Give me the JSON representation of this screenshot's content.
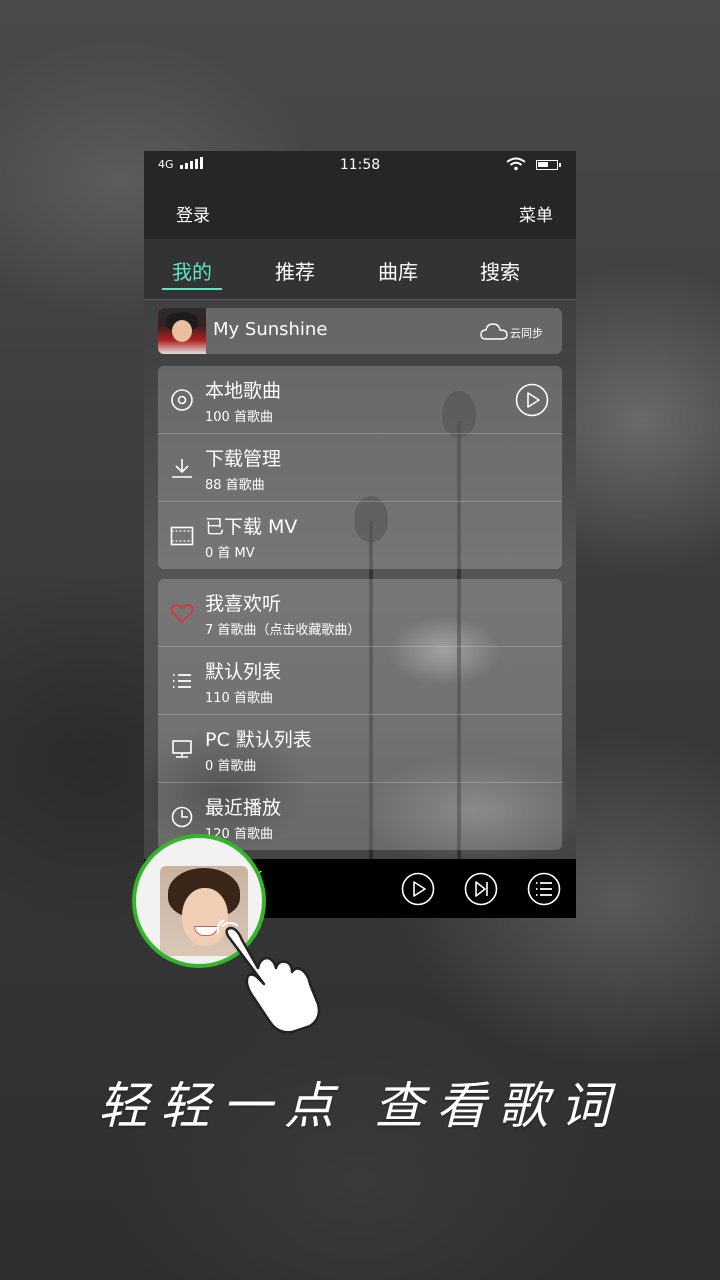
{
  "status_bar": {
    "network": "4G",
    "time": "11:58"
  },
  "header": {
    "login_label": "登录",
    "menu_label": "菜单"
  },
  "tabs": [
    {
      "label": "我的",
      "active": true
    },
    {
      "label": "推荐",
      "active": false
    },
    {
      "label": "曲库",
      "active": false
    },
    {
      "label": "搜索",
      "active": false
    }
  ],
  "profile": {
    "name": "My Sunshine",
    "sync_label": "云同步",
    "icon": "cloud-icon"
  },
  "group1": [
    {
      "icon": "disc-icon",
      "title": "本地歌曲",
      "subtitle": "100 首歌曲"
    },
    {
      "icon": "download-icon",
      "title": "下载管理",
      "subtitle": "88 首歌曲"
    },
    {
      "icon": "video-icon",
      "title": "已下载 MV",
      "subtitle": "0 首 MV"
    }
  ],
  "group2": [
    {
      "icon": "heart-icon",
      "title": "我喜欢听",
      "subtitle": "7 首歌曲（点击收藏歌曲）"
    },
    {
      "icon": "list-icon",
      "title": "默认列表",
      "subtitle": "110 首歌曲"
    },
    {
      "icon": "monitor-icon",
      "title": "PC 默认列表",
      "subtitle": "0 首歌曲"
    },
    {
      "icon": "clock-icon",
      "title": "最近播放",
      "subtitle": "120 首歌曲"
    }
  ],
  "player": {
    "partial_text": "k"
  },
  "caption": "轻轻一点 查看歌词",
  "colors": {
    "accent": "#5ee3c6",
    "ring": "#35b52b",
    "heart": "#e0322c"
  }
}
